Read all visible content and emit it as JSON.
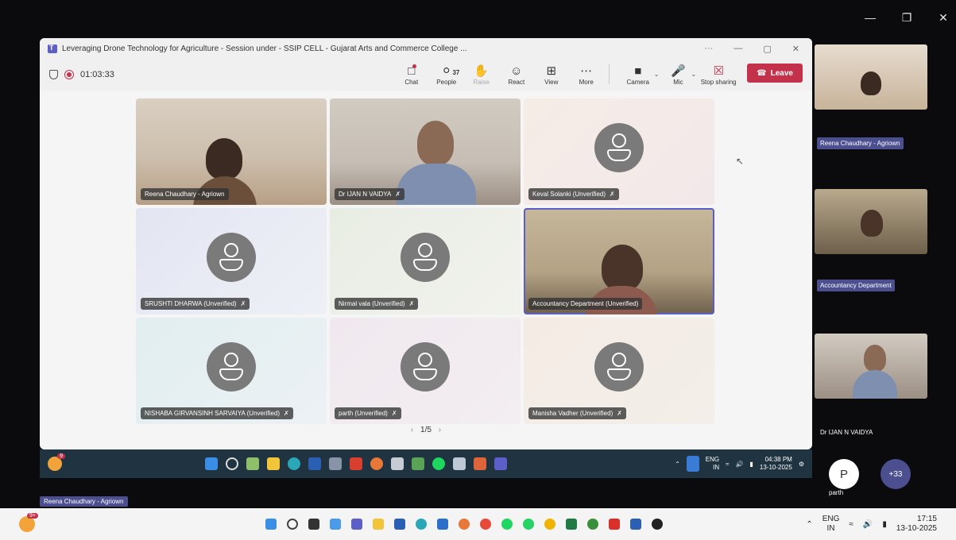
{
  "window": {
    "title": "Leveraging Drone Technology for Agriculture - Session under - SSIP CELL - Gujarat Arts and Commerce College ...",
    "more": "···",
    "minimize": "—",
    "maximize": "▢",
    "close": "✕"
  },
  "outer_window_controls": {
    "minimize": "—",
    "restore": "❐",
    "close": "✕"
  },
  "meeting": {
    "timer": "01:03:33"
  },
  "toolbar": {
    "chat": "Chat",
    "people": "People",
    "people_count": "37",
    "raise": "Raise",
    "react": "React",
    "view": "View",
    "more": "More",
    "camera": "Camera",
    "mic": "Mic",
    "stop_sharing": "Stop sharing",
    "leave": "Leave"
  },
  "tiles": [
    {
      "name": "Reena Chaudhary - Agriown",
      "video": true
    },
    {
      "name": "Dr IJAN N VAIDYA",
      "video": true
    },
    {
      "name": "Keval Solanki (Unverified)",
      "video": false
    },
    {
      "name": "SRUSHTI DHARWA (Unverified)",
      "video": false
    },
    {
      "name": "Nirmal vala (Unverified)",
      "video": false
    },
    {
      "name": "Accountancy Department (Unverified)",
      "video": true
    },
    {
      "name": "NISHABA GIRVANSINH SARVAIYA (Unverified)",
      "video": false
    },
    {
      "name": "parth (Unverified)",
      "video": false
    },
    {
      "name": "Manisha Vadher (Unverified)",
      "video": false
    }
  ],
  "pager": {
    "label": "1/5",
    "prev": "‹",
    "next": "›"
  },
  "inner_taskbar": {
    "badge": "9",
    "lang_top": "ENG",
    "lang_bottom": "IN",
    "time": "04:38 PM",
    "date": "13-10-2025"
  },
  "side_panel": {
    "labels": [
      "Reena Chaudhary - Agriown",
      "Accountancy Department",
      "Dr IJAN N VAIDYA"
    ],
    "p_initial": "P",
    "p_name": "parth",
    "more_count": "+33"
  },
  "presenter_label": "Reena Chaudhary - Agriown",
  "outer_taskbar": {
    "badge": "9+",
    "lang_top": "ENG",
    "lang_bottom": "IN",
    "time": "17:15",
    "date": "13-10-2025"
  },
  "colors": {
    "accent": "#5b5fc7",
    "leave": "#c4314b",
    "label_bg": "#4b4f8f"
  }
}
